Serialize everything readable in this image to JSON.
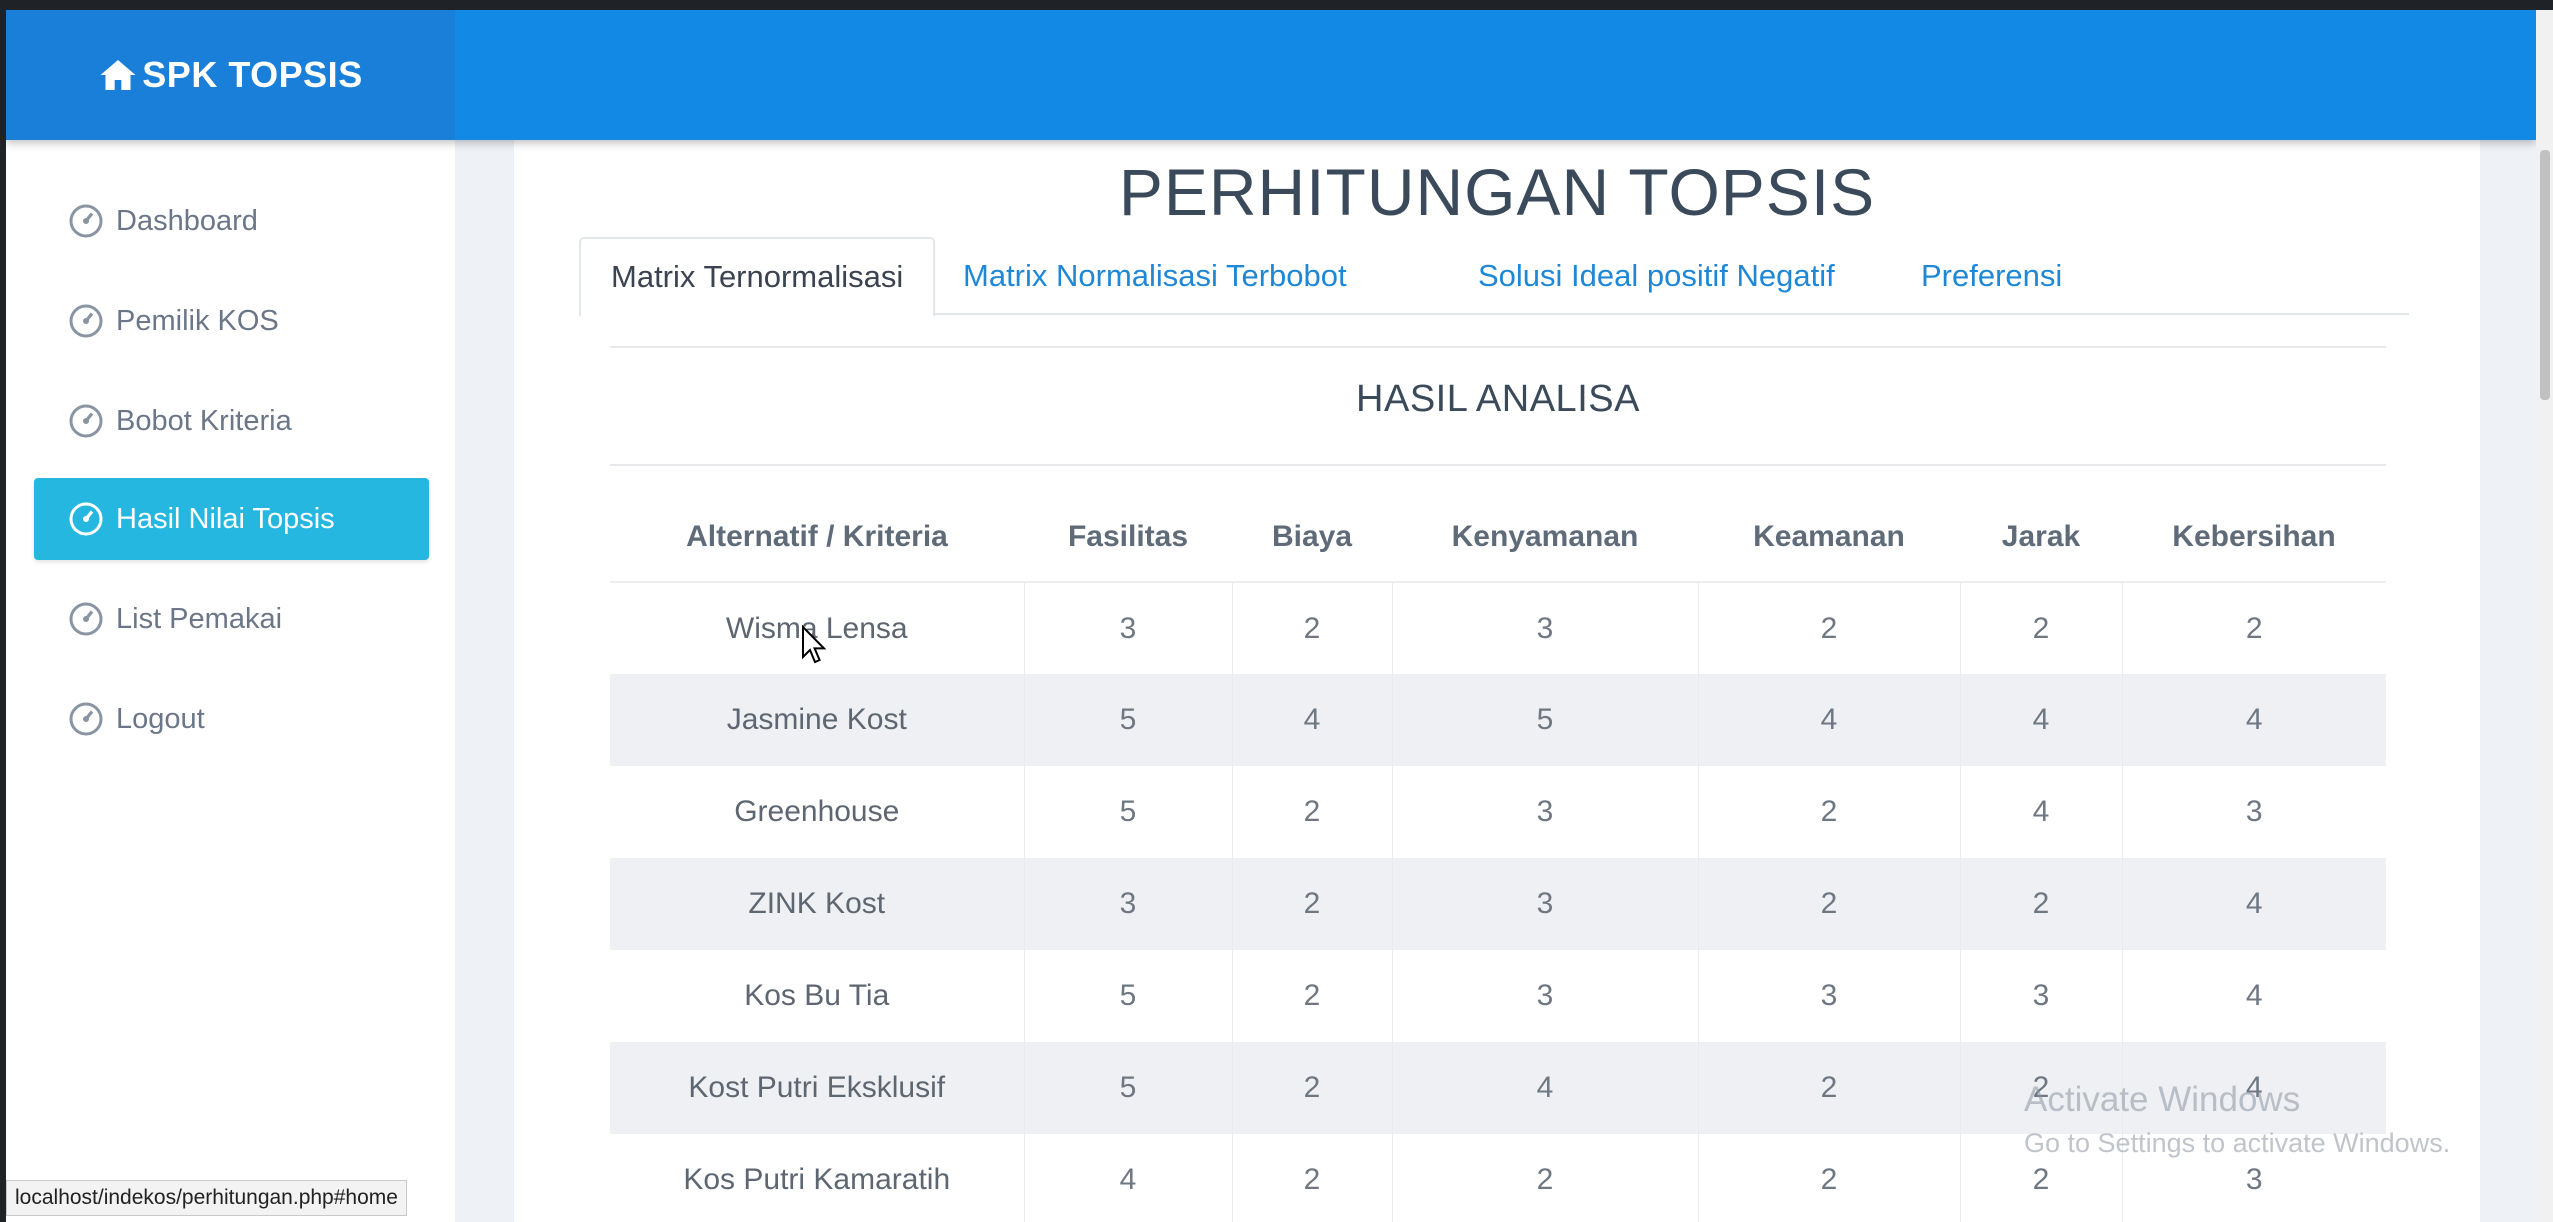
{
  "brand": {
    "title": "SPK TOPSIS",
    "icon": "home-icon"
  },
  "sidebar": {
    "items": [
      {
        "label": "Dashboard",
        "icon": "dashboard-icon",
        "active": false
      },
      {
        "label": "Pemilik KOS",
        "icon": "dashboard-icon",
        "active": false
      },
      {
        "label": "Bobot Kriteria",
        "icon": "dashboard-icon",
        "active": false
      },
      {
        "label": "Hasil Nilai Topsis",
        "icon": "dashboard-icon",
        "active": true
      },
      {
        "label": "List Pemakai",
        "icon": "dashboard-icon",
        "active": false
      },
      {
        "label": "Logout",
        "icon": "dashboard-icon",
        "active": false
      }
    ]
  },
  "main": {
    "title": "PERHITUNGAN TOPSIS",
    "tabs": [
      {
        "label": "Matrix Ternormalisasi",
        "active": true
      },
      {
        "label": "Matrix Normalisasi Terbobot",
        "active": false
      },
      {
        "label": "Solusi Ideal positif Negatif",
        "active": false
      },
      {
        "label": "Preferensi",
        "active": false
      }
    ],
    "section_title": "HASIL ANALISA",
    "table": {
      "headers": [
        "Alternatif / Kriteria",
        "Fasilitas",
        "Biaya",
        "Kenyamanan",
        "Keamanan",
        "Jarak",
        "Kebersihan"
      ],
      "rows": [
        [
          "Wisma Lensa",
          "3",
          "2",
          "3",
          "2",
          "2",
          "2"
        ],
        [
          "Jasmine Kost",
          "5",
          "4",
          "5",
          "4",
          "4",
          "4"
        ],
        [
          "Greenhouse",
          "5",
          "2",
          "3",
          "2",
          "4",
          "3"
        ],
        [
          "ZINK Kost",
          "3",
          "2",
          "3",
          "2",
          "2",
          "4"
        ],
        [
          "Kos Bu Tia",
          "5",
          "2",
          "3",
          "3",
          "3",
          "4"
        ],
        [
          "Kost Putri Eksklusif",
          "5",
          "2",
          "4",
          "2",
          "2",
          "4"
        ],
        [
          "Kos Putri Kamaratih",
          "4",
          "2",
          "2",
          "2",
          "2",
          "3"
        ]
      ]
    }
  },
  "watermark": {
    "line1": "Activate Windows",
    "line2": "Go to Settings to activate Windows."
  },
  "status_url": "localhost/indekos/perhitungan.php#home",
  "colors": {
    "topbar": "#1289e4",
    "brand_bg": "#1a7fd9",
    "active_nav": "#25b7e0",
    "tab_link": "#1f88d6"
  }
}
